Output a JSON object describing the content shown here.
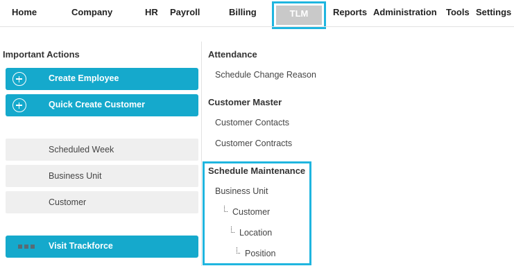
{
  "nav": {
    "items": [
      "Home",
      "Company",
      "HR",
      "Payroll",
      "Billing",
      "TLM",
      "Reports",
      "Administration",
      "Tools",
      "Settings"
    ]
  },
  "left": {
    "heading": "Important Actions",
    "actions": [
      {
        "label": "Create Employee",
        "icon": "plus-circle-icon"
      },
      {
        "label": "Quick Create Customer",
        "icon": "plus-circle-icon"
      }
    ],
    "shortcuts": [
      "Scheduled Week",
      "Business Unit",
      "Customer"
    ],
    "trackforce": {
      "label": "Visit Trackforce",
      "icon": "grid-icon"
    }
  },
  "right": {
    "attendance": {
      "heading": "Attendance",
      "items": [
        "Schedule Change Reason"
      ]
    },
    "customer_master": {
      "heading": "Customer Master",
      "items": [
        "Customer Contacts",
        "Customer Contracts"
      ]
    },
    "schedule_maintenance": {
      "heading": "Schedule Maintenance",
      "items": [
        "Business Unit",
        "Customer",
        "Location",
        "Position"
      ]
    }
  },
  "colors": {
    "accent": "#15a9cc",
    "highlight": "#1fb5df",
    "active_tab_bg": "#c9c9c9",
    "shortcut_bg": "#efefef"
  }
}
